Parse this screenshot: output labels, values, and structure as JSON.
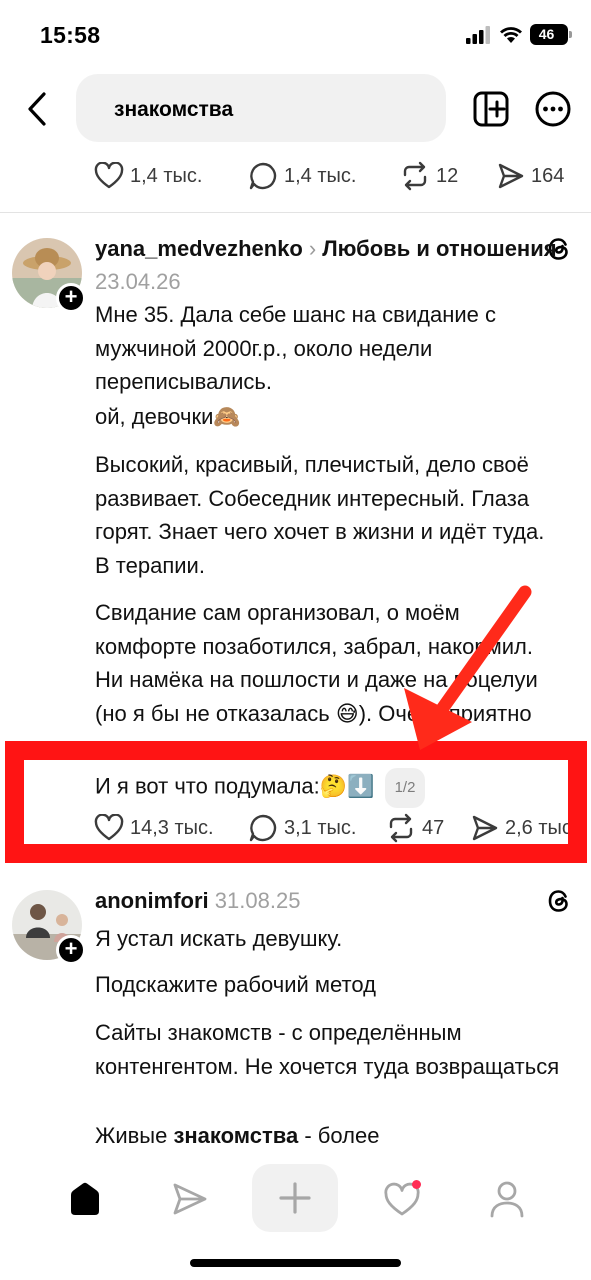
{
  "status_bar": {
    "time": "15:58",
    "battery": "46"
  },
  "search": {
    "query": "знакомства"
  },
  "top_actions": {
    "likes": "1,4 тыс.",
    "comments": "1,4 тыс.",
    "reposts": "12",
    "shares": "164"
  },
  "post1": {
    "username": "yana_medvezhenko",
    "topic": "Любовь и отношения",
    "date": "23.04.26",
    "paragraphs": [
      "Мне 35. Дала себе шанс на свидание с мужчиной 2000г.р., около недели переписывались.",
      "ой, девочки🙈",
      "Высокий, красивый, плечистый, дело своё развивает. Собеседник интересный. Глаза горят. Знает чего хочет в жизни и идёт туда.  В терапии.",
      "Свидание сам организовал, о моём комфорте позаботился, забрал, накормил. Ни намёка на пошлости и даже на поцелуи (но я бы не отказалась 😅). Очень приятно провели вечер.",
      "И я вот что подумала:🤔⬇️"
    ],
    "page": "1/2",
    "likes": "14,3 тыс.",
    "comments": "3,1 тыс.",
    "reposts": "47",
    "shares": "2,6 тыс."
  },
  "post2": {
    "username": "anonimfori",
    "date": "31.08.25",
    "paragraphs": [
      "Я устал искать девушку.",
      "Подскажите рабочий метод",
      "Сайты знакомств - с определённым контенгентом. Не хочется туда возвращаться"
    ],
    "last_line_prefix": "Живые ",
    "last_line_bold": "знакомства",
    "last_line_suffix": " - более"
  },
  "colors": {
    "highlight": "#ff1414",
    "notification": "#ff2d55"
  },
  "icons": [
    "back-arrow-icon",
    "add-feed-icon",
    "more-icon",
    "heart-icon",
    "comment-icon",
    "repost-icon",
    "share-icon",
    "threads-icon",
    "home-icon",
    "send-icon",
    "plus-icon",
    "activity-heart-icon",
    "profile-icon"
  ]
}
